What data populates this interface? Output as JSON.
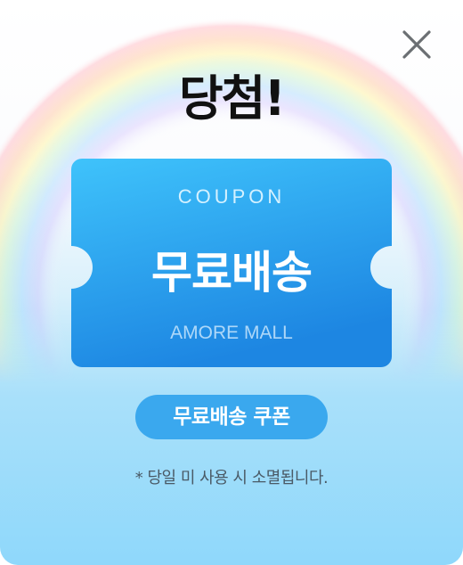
{
  "modal": {
    "title": "당첨!",
    "close_icon": "close-icon"
  },
  "coupon": {
    "label": "COUPON",
    "name": "무료배송",
    "brand": "AMORE MALL"
  },
  "badge": {
    "label": "무료배송 쿠폰"
  },
  "notice": "* 당일 미 사용 시 소멸됩니다.",
  "colors": {
    "ticket_top": "#3fc3fb",
    "ticket_bottom": "#1d86e2",
    "badge": "#3aa8ee",
    "title": "#111111"
  }
}
